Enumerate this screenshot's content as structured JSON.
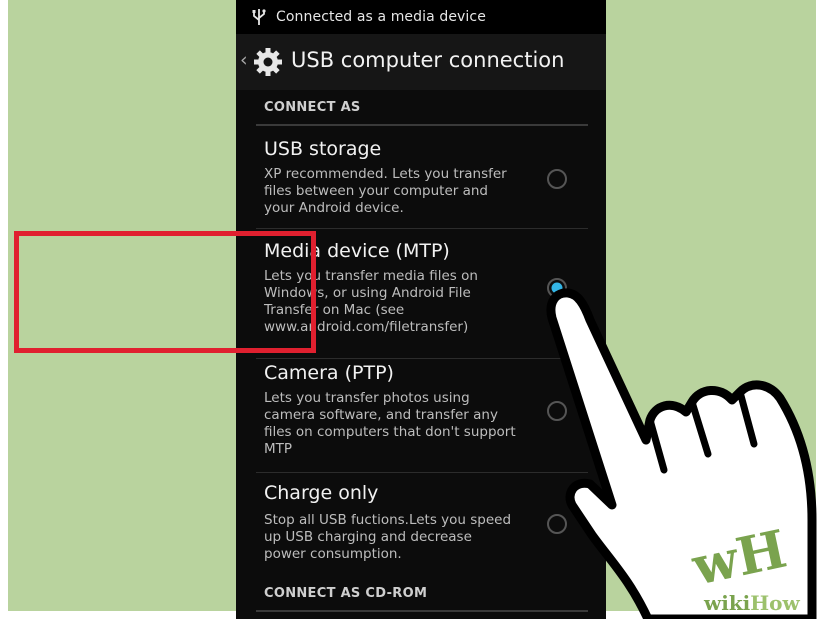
{
  "status_bar": {
    "icon": "usb-icon",
    "text": "Connected as a media device"
  },
  "action_bar": {
    "back_icon": "chevron-left-icon",
    "settings_icon": "gear-icon",
    "title": "USB computer connection"
  },
  "sections": {
    "connect_as": "CONNECT AS",
    "connect_as_cdrom": "CONNECT AS CD-ROM"
  },
  "options": [
    {
      "title": "USB storage",
      "desc_lines": [
        "XP recommended. Lets you transfer",
        "files between your computer and",
        "your Android device."
      ],
      "selected": false
    },
    {
      "title": "Media device (MTP)",
      "desc_lines": [
        "Lets you transfer media files on",
        "Windows, or using Android File",
        "Transfer on Mac (see",
        "www.android.com/filetransfer)"
      ],
      "selected": true
    },
    {
      "title": "Camera (PTP)",
      "desc_lines": [
        "Lets you transfer photos using",
        "camera software, and transfer any",
        "files on computers that don't support",
        "MTP"
      ],
      "selected": false
    },
    {
      "title": "Charge only",
      "desc_lines": [
        "Stop all USB fuctions.Lets you speed",
        "up USB charging and decrease",
        "power consumption."
      ],
      "selected": false
    }
  ],
  "colors": {
    "highlight": "#e0202f",
    "radio_selected": "#33b5e5",
    "background_green": "#b9d39e"
  },
  "watermark": {
    "logo": "wH",
    "text_wiki": "wiki",
    "text_how": "How"
  }
}
